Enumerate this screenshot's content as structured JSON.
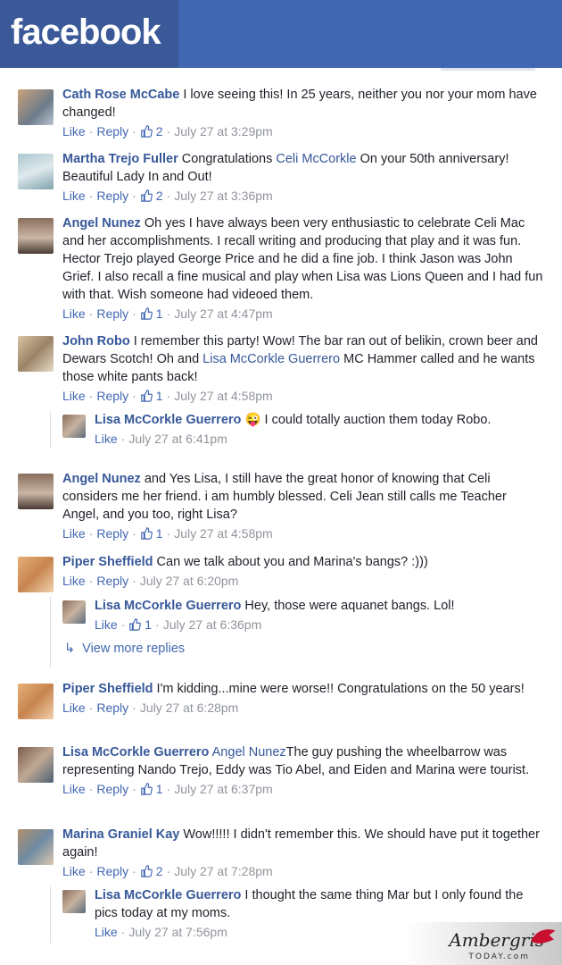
{
  "header": {
    "logo": "facebook"
  },
  "meta_labels": {
    "like": "Like",
    "reply": "Reply",
    "dot": "·"
  },
  "comments": [
    {
      "name": "Cath Rose McCabe",
      "text": " I love seeing this! In 25 years, neither you nor your mom have changed!",
      "likes": "2",
      "time": "July 27 at 3:29pm"
    },
    {
      "name": "Martha Trejo Fuller",
      "pre": " Congratulations ",
      "mention": "Celi McCorkle",
      "text": " On your 50th anniversary! Beautiful Lady In and Out!",
      "likes": "2",
      "time": "July 27 at 3:36pm"
    },
    {
      "name": "Angel Nunez",
      "text": " Oh yes I have always been very enthusiastic to celebrate Celi Mac and her accomplishments. I recall writing and producing that play and it was fun. Hector Trejo played George Price and he did a fine job. I think Jason was John Grief. I also recall a fine musical and play when Lisa was Lions Queen and I had fun with that. Wish someone had videoed them.",
      "likes": "1",
      "time": "July 27 at 4:47pm"
    },
    {
      "name": "John Robo",
      "pre": " I remember this party! Wow! The bar ran out of belikin, crown beer and Dewars Scotch! Oh and ",
      "mention": "Lisa McCorkle Guerrero",
      "text": " MC Hammer called and he wants those white pants back!",
      "likes": "1",
      "time": "July 27 at 4:58pm"
    },
    {
      "name": "Lisa McCorkle Guerrero",
      "emoji": "😜",
      "text": " I could totally auction them today Robo.",
      "time": "July 27 at 6:41pm"
    },
    {
      "name": "Angel Nunez",
      "text": " and Yes Lisa, I still have the great honor of knowing that Celi considers me her friend. i am humbly blessed. Celi Jean still calls me Teacher Angel, and you too, right Lisa?",
      "likes": "1",
      "time": "July 27 at 4:58pm"
    },
    {
      "name": "Piper Sheffield",
      "text": " Can we talk about you and Marina's bangs? :)))",
      "time": "July 27 at 6:20pm"
    },
    {
      "name": "Lisa McCorkle Guerrero",
      "text": " Hey, those were aquanet bangs. Lol!",
      "likes": "1",
      "time": "July 27 at 6:36pm"
    },
    {
      "name": "Piper Sheffield",
      "text": " I'm kidding...mine were worse!! Congratulations on the 50 years!",
      "time": "July 27 at 6:28pm"
    },
    {
      "name": "Lisa McCorkle Guerrero",
      "pre": " ",
      "mention": "Angel Nunez",
      "text": "The guy pushing the wheelbarrow was representing Nando Trejo, Eddy was Tio Abel, and Eiden and Marina were tourist.",
      "likes": "1",
      "time": "July 27 at 6:37pm"
    },
    {
      "name": "Marina Graniel Kay",
      "text": " Wow!!!!! I didn't remember this. We should have put it together again!",
      "likes": "2",
      "time": "July 27 at 7:28pm"
    },
    {
      "name": "Lisa McCorkle Guerrero",
      "text": " I thought the same thing Mar but I only found the pics today at my moms.",
      "time": "July 27 at 7:56pm"
    }
  ],
  "view_more": "View more replies",
  "watermark": {
    "brand": "Ambergris",
    "sub": "TODAY",
    "domain": ".com"
  },
  "colors": {
    "header": "#4267b2",
    "link": "#365899",
    "meta": "#90949c"
  }
}
